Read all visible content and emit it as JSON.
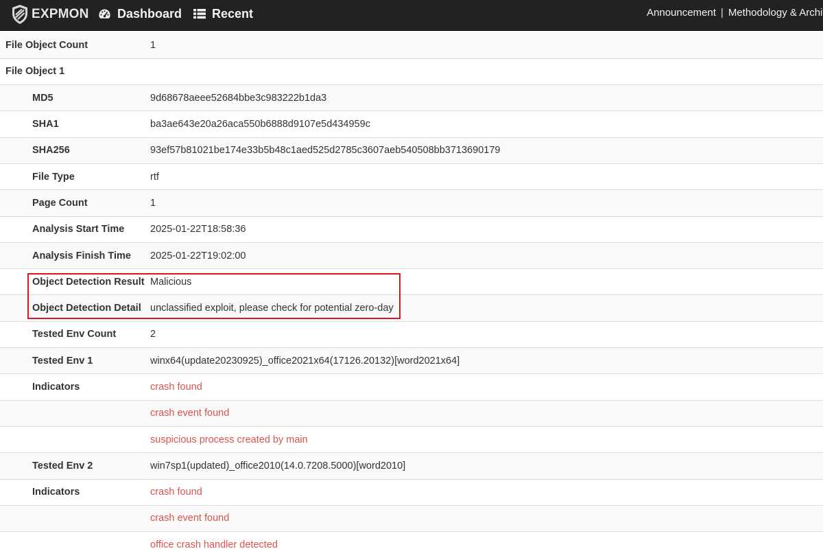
{
  "navbar": {
    "brand": "EXPMON",
    "dashboard_label": "Dashboard",
    "recent_label": "Recent",
    "announcement_label": "Announcement",
    "separator": "|",
    "methodology_label": "Methodology & Architecture"
  },
  "report": {
    "rows": [
      {
        "key": "File Object Count",
        "value": "1"
      },
      {
        "key": "File Object 1",
        "value": ""
      },
      {
        "key": "MD5",
        "value": "9d68678aeee52684bbe3c983222b1da3"
      },
      {
        "key": "SHA1",
        "value": "ba3ae643e20a26aca550b6888d9107e5d434959c"
      },
      {
        "key": "SHA256",
        "value": "93ef57b81021be174e33b5b48c1aed525d2785c3607aeb540508bb3713690179"
      },
      {
        "key": "File Type",
        "value": "rtf"
      },
      {
        "key": "Page Count",
        "value": "1"
      },
      {
        "key": "Analysis Start Time",
        "value": "2025-01-22T18:58:36"
      },
      {
        "key": "Analysis Finish Time",
        "value": "2025-01-22T19:02:00"
      },
      {
        "key": "Object Detection Result",
        "value": "Malicious"
      },
      {
        "key": "Object Detection Detail",
        "value": "unclassified exploit, please check for potential zero-day"
      },
      {
        "key": "Tested Env Count",
        "value": "2"
      },
      {
        "key": "Tested Env 1",
        "value": "winx64(update20230925)_office2021x64(17126.20132)[word2021x64]"
      },
      {
        "key": "Indicators",
        "value": "crash found"
      },
      {
        "key": "",
        "value": "crash event found"
      },
      {
        "key": "",
        "value": "suspicious process created by main"
      },
      {
        "key": "Tested Env 2",
        "value": "win7sp1(updated)_office2010(14.0.7208.5000)[word2010]"
      },
      {
        "key": "Indicators",
        "value": "crash found"
      },
      {
        "key": "",
        "value": "crash event found"
      },
      {
        "key": "",
        "value": "office crash handler detected"
      }
    ]
  },
  "colors": {
    "navbar_bg": "#222222",
    "indicator_text": "#d9534f",
    "highlight_border": "#e0141e",
    "stripe": "#f9f9f9"
  },
  "icons": {
    "brand": "shield-icon",
    "dashboard": "speedometer-icon",
    "recent": "list-icon"
  }
}
